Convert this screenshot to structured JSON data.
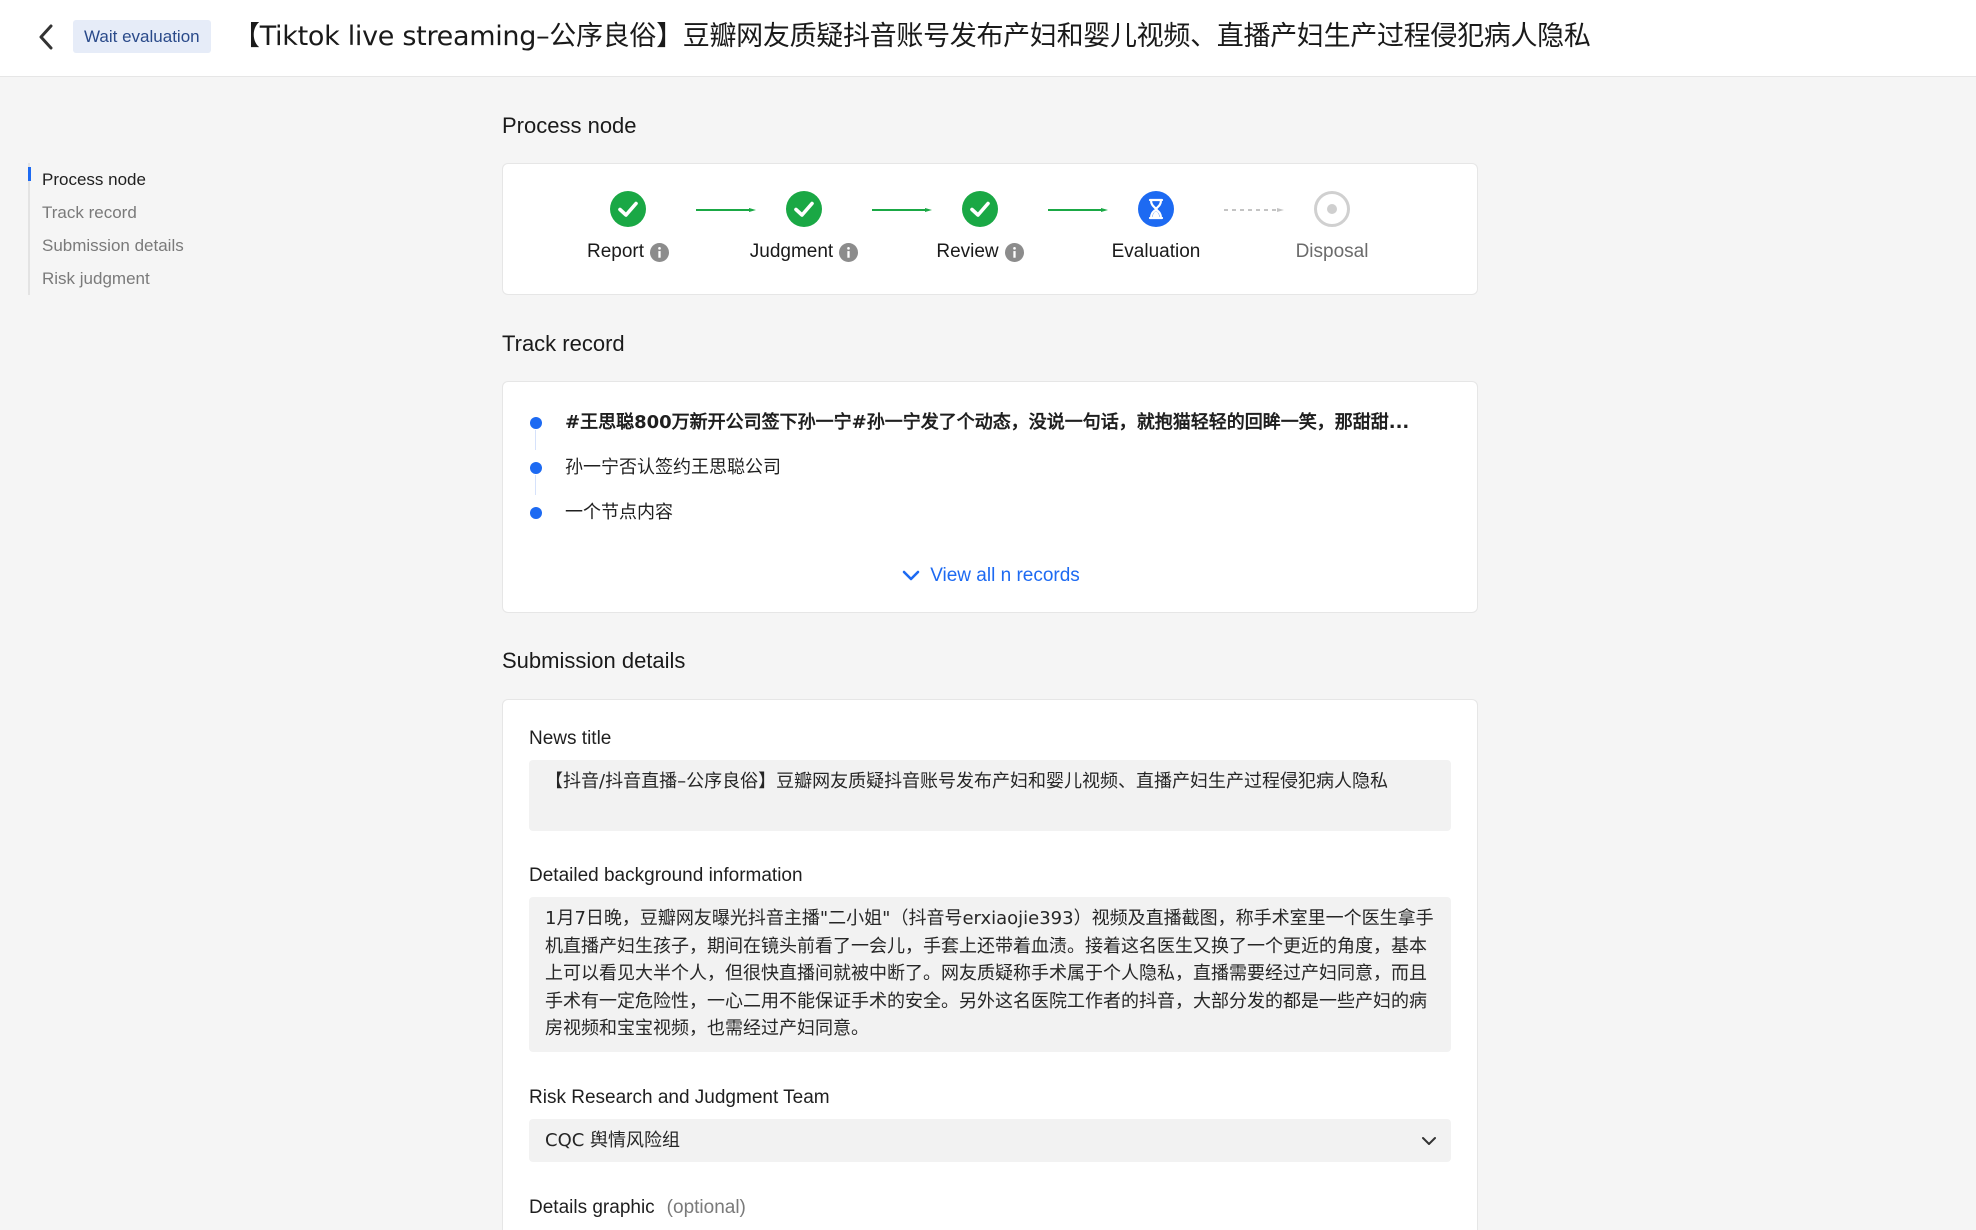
{
  "header": {
    "status_tag": "Wait evaluation",
    "title": "【Tiktok live streaming–公序良俗】豆瓣网友质疑抖音账号发布产妇和婴儿视频、直播产妇生产过程侵犯病人隐私"
  },
  "anchor_nav": {
    "items": [
      {
        "label": "Process node"
      },
      {
        "label": "Track record"
      },
      {
        "label": "Submission details"
      },
      {
        "label": "Risk judgment"
      }
    ]
  },
  "process": {
    "section_title": "Process node",
    "steps": [
      {
        "label": "Report",
        "state": "done",
        "has_info": true
      },
      {
        "label": "Judgment",
        "state": "done",
        "has_info": true
      },
      {
        "label": "Review",
        "state": "done",
        "has_info": true
      },
      {
        "label": "Evaluation",
        "state": "current",
        "has_info": false
      },
      {
        "label": "Disposal",
        "state": "pending",
        "has_info": false
      }
    ]
  },
  "track": {
    "section_title": "Track record",
    "records": [
      {
        "text": "#王思聪800万新开公司签下孙一宁#孙一宁发了个动态，没说一句话，就抱猫轻轻的回眸一笑，那甜甜..."
      },
      {
        "text": "孙一宁否认签约王思聪公司"
      },
      {
        "text": "一个节点内容"
      }
    ],
    "view_all": "View all n records"
  },
  "submission": {
    "section_title": "Submission details",
    "news_title_label": "News title",
    "news_title_value": "【抖音/抖音直播–公序良俗】豆瓣网友质疑抖音账号发布产妇和婴儿视频、直播产妇生产过程侵犯病人隐私",
    "background_label": "Detailed background information",
    "background_value": "1月7日晚，豆瓣网友曝光抖音主播\"二小姐\"（抖音号erxiaojie393）视频及直播截图，称手术室里一个医生拿手机直播产妇生孩子，期间在镜头前看了一会儿，手套上还带着血渍。接着这名医生又换了一个更近的角度，基本上可以看见大半个人，但很快直播间就被中断了。网友质疑称手术属于个人隐私，直播需要经过产妇同意，而且手术有一定危险性，一心二用不能保证手术的安全。另外这名医院工作者的抖音，大部分发的都是一些产妇的病房视频和宝宝视频，也需经过产妇同意。",
    "team_label": "Risk Research and Judgment Team",
    "team_value": "CQC 舆情风险组",
    "graphic_label": "Details graphic",
    "graphic_optional": "(optional)"
  },
  "colors": {
    "accent": "#1d6af2",
    "success": "#1aa845",
    "tag_bg": "#e6ecf8"
  }
}
